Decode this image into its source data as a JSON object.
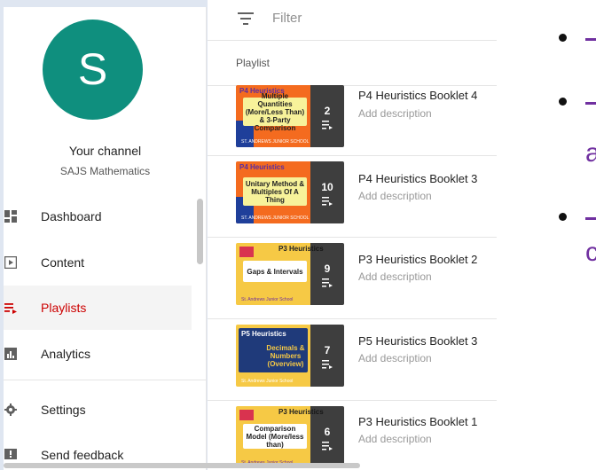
{
  "channel": {
    "avatar_letter": "S",
    "title": "Your channel",
    "name": "SAJS Mathematics"
  },
  "nav": [
    {
      "label": "Dashboard",
      "icon": "dashboard-icon",
      "active": false
    },
    {
      "label": "Content",
      "icon": "content-icon",
      "active": false
    },
    {
      "label": "Playlists",
      "icon": "playlists-icon",
      "active": true
    },
    {
      "label": "Analytics",
      "icon": "analytics-icon",
      "active": false
    },
    {
      "label": "Settings",
      "icon": "settings-icon",
      "active": false
    },
    {
      "label": "Send feedback",
      "icon": "feedback-icon",
      "active": false
    }
  ],
  "filter": {
    "placeholder": "Filter",
    "icon": "filter-icon"
  },
  "table": {
    "column_header": "Playlist"
  },
  "playlists": [
    {
      "title": "P4 Heuristics Booklet 4",
      "description": "Add description",
      "count": "2",
      "thumb_heading": "P4 Heuristics",
      "thumb_text": "Multiple Quantities (More/Less Than) & 3-Party Comparison",
      "thumb_footer": "ST. ANDREWS JUNIOR SCHOOL"
    },
    {
      "title": "P4 Heuristics Booklet 3",
      "description": "Add description",
      "count": "10",
      "thumb_heading": "P4 Heuristics",
      "thumb_text": "Unitary Method & Multiples Of A Thing",
      "thumb_footer": "ST. ANDREWS JUNIOR SCHOOL"
    },
    {
      "title": "P3 Heuristics Booklet 2",
      "description": "Add description",
      "count": "9",
      "thumb_heading": "P3 Heuristics",
      "thumb_text": "Gaps & Intervals",
      "thumb_footer": "St. Andrews Junior School"
    },
    {
      "title": "P5 Heuristics Booklet 3",
      "description": "Add description",
      "count": "7",
      "thumb_heading": "P5 Heuristics",
      "thumb_text": "Decimals & Numbers (Overview)",
      "thumb_footer": "St. Andrews Junior School"
    },
    {
      "title": "P3 Heuristics Booklet 1",
      "description": "Add description",
      "count": "6",
      "thumb_heading": "P3 Heuristics",
      "thumb_text": "Comparison Model (More/less than)",
      "thumb_footer": "St. Andrews Junior School"
    }
  ],
  "slide_fragments": [
    "a",
    "c"
  ],
  "colors": {
    "active_red": "#cc0000",
    "avatar": "#0f8f7e",
    "slide_purple": "#7030a0"
  }
}
